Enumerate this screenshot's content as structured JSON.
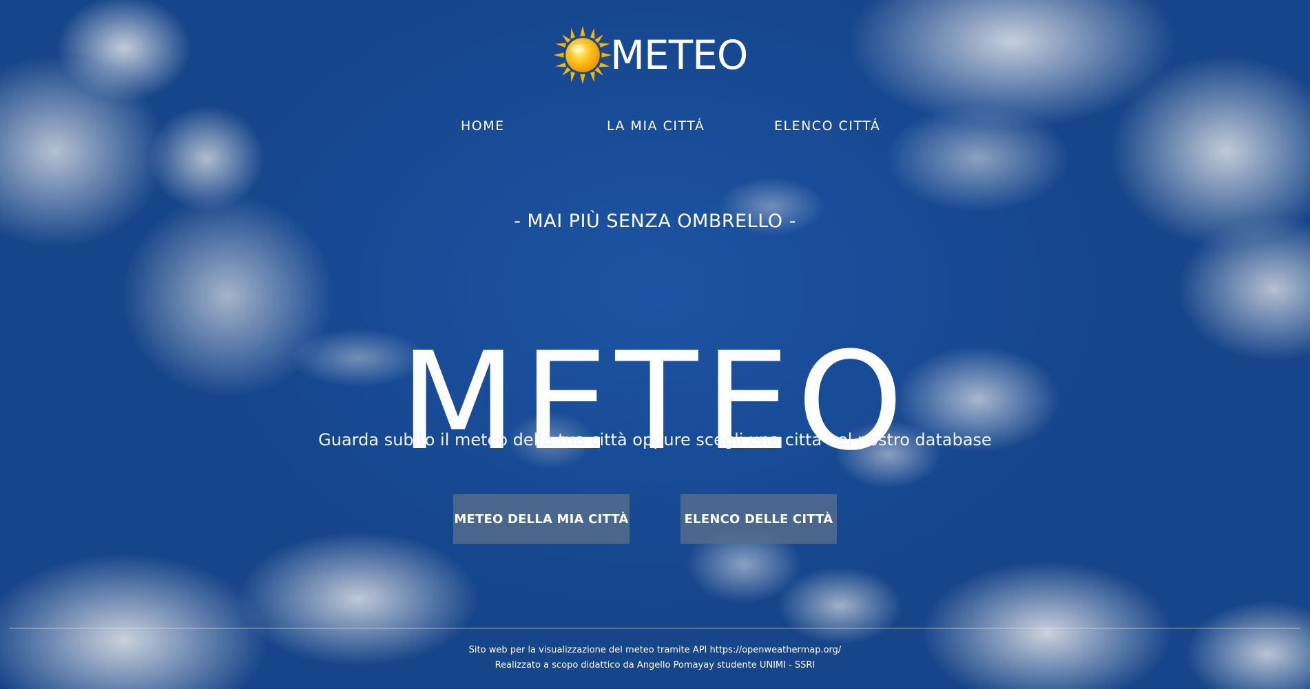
{
  "logo": {
    "text": "METEO",
    "icon": "sun-icon",
    "sun_color": "#f5b800"
  },
  "nav": {
    "items": [
      {
        "label": "HOME"
      },
      {
        "label": "LA MIA CITTÁ"
      },
      {
        "label": "ELENCO CITTÁ"
      }
    ]
  },
  "hero": {
    "tagline": "- MAI PIÙ SENZA OMBRELLO -",
    "title": "METEO",
    "subtitle": "Guarda subito il meteo della tua città oppure scegli una città nel nostro database"
  },
  "buttons": {
    "my_city": "METEO DELLA MIA CITTÀ",
    "city_list": "ELENCO DELLE CITTÀ"
  },
  "footer": {
    "line1": "Sito web per la visualizzazione del meteo tramite API https://openweathermap.org/",
    "line2": "Realizzato a scopo didattico da Angello Pomayay studente UNIMI - SSRI"
  },
  "colors": {
    "sky": "#1c56a6",
    "button_bg": "#546c8c",
    "text": "#ffffff"
  }
}
